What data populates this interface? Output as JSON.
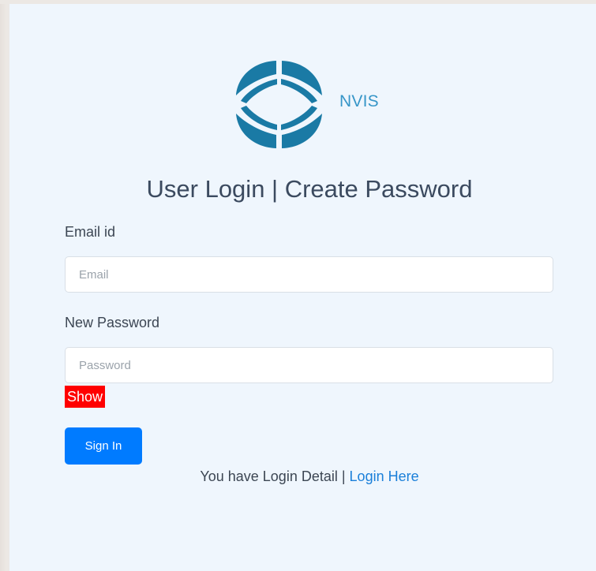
{
  "brand": {
    "logo_icon": "nvis-logo-icon",
    "name": "NVIS",
    "color": "#3796c8",
    "logo_color": "#1a7aa5"
  },
  "page": {
    "title": "User Login | Create Password"
  },
  "form": {
    "email_label": "Email id",
    "email_placeholder": "Email",
    "email_value": "",
    "password_label": "New Password",
    "password_placeholder": "Password",
    "password_value": "",
    "show_label": "Show",
    "show_color": "#ff0000",
    "submit_label": "Sign In",
    "submit_color": "#007bff"
  },
  "footer": {
    "text": "You have Login Detail |",
    "link_label": "Login Here"
  }
}
